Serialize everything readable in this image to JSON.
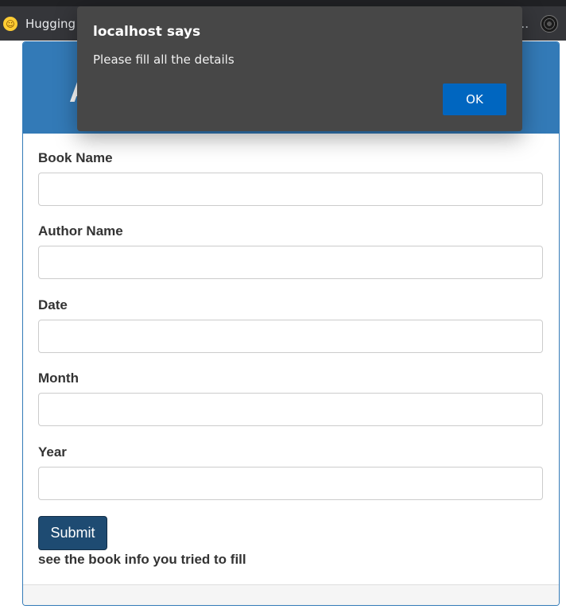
{
  "browser": {
    "bookmark_label": "Hugging",
    "bookmark_icon": "hugging-face-icon",
    "overflow": "..."
  },
  "page": {
    "heading_visible_letter": "A",
    "fields": [
      {
        "label": "Book Name",
        "value": "",
        "placeholder": ""
      },
      {
        "label": "Author Name",
        "value": "",
        "placeholder": ""
      },
      {
        "label": "Date",
        "value": "",
        "placeholder": ""
      },
      {
        "label": "Month",
        "value": "",
        "placeholder": ""
      },
      {
        "label": "Year",
        "value": "",
        "placeholder": ""
      }
    ],
    "submit_label": "Submit",
    "info_text": "see the book info you tried to fill"
  },
  "dialog": {
    "title": "localhost says",
    "message": "Please fill all the details",
    "ok_label": "OK"
  },
  "colors": {
    "heading_bg": "#337ab7",
    "submit_bg": "#1e4b72",
    "dialog_bg": "#474747",
    "ok_button_bg": "#0066c0"
  }
}
